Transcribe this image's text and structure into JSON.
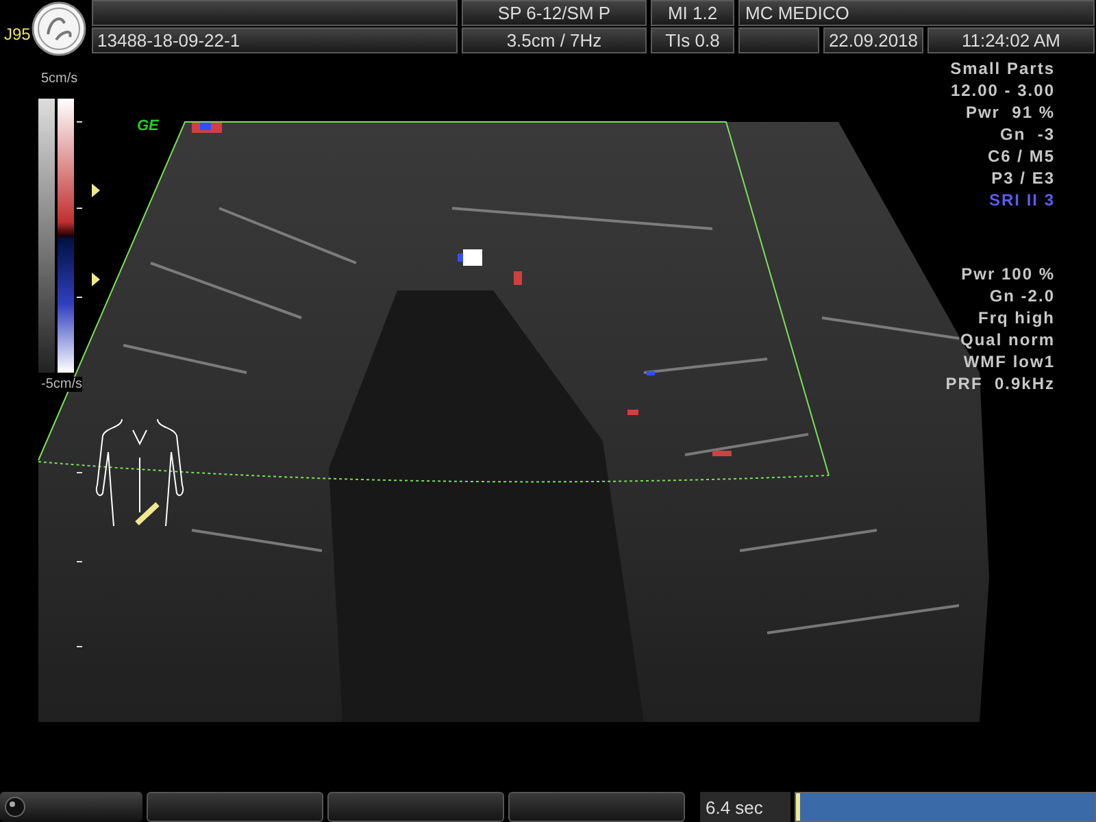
{
  "header": {
    "system_id": "J95",
    "patient_id": "13488-18-09-22-1",
    "probe": "SP 6-12/SM P",
    "depth_rate": "3.5cm /  7Hz",
    "mi": "MI  1.2",
    "tis": "TIs  0.8",
    "institution": "MC MEDICO",
    "date": "22.09.2018",
    "time": "11:24:02 AM"
  },
  "color_scale": {
    "top": "5cm/s",
    "bottom": "-5cm/s"
  },
  "image": {
    "mark": "GE"
  },
  "bmode_params": [
    {
      "text": "Small Parts",
      "highlight": false
    },
    {
      "text": "12.00 - 3.00",
      "highlight": false
    },
    {
      "text": "Pwr  91 %",
      "highlight": false
    },
    {
      "text": "Gn  -3",
      "highlight": false
    },
    {
      "text": "C6 / M5",
      "highlight": false
    },
    {
      "text": "P3 / E3",
      "highlight": false
    },
    {
      "text": "SRI II 3",
      "highlight": true
    }
  ],
  "color_params": [
    {
      "text": "Pwr 100 %",
      "highlight": false
    },
    {
      "text": "Gn -2.0",
      "highlight": false
    },
    {
      "text": "Frq high",
      "highlight": false
    },
    {
      "text": "Qual norm",
      "highlight": false
    },
    {
      "text": "WMF low1",
      "highlight": false
    },
    {
      "text": "PRF  0.9kHz",
      "highlight": false
    }
  ],
  "cine": {
    "duration": "6.4 sec",
    "level": 0
  }
}
